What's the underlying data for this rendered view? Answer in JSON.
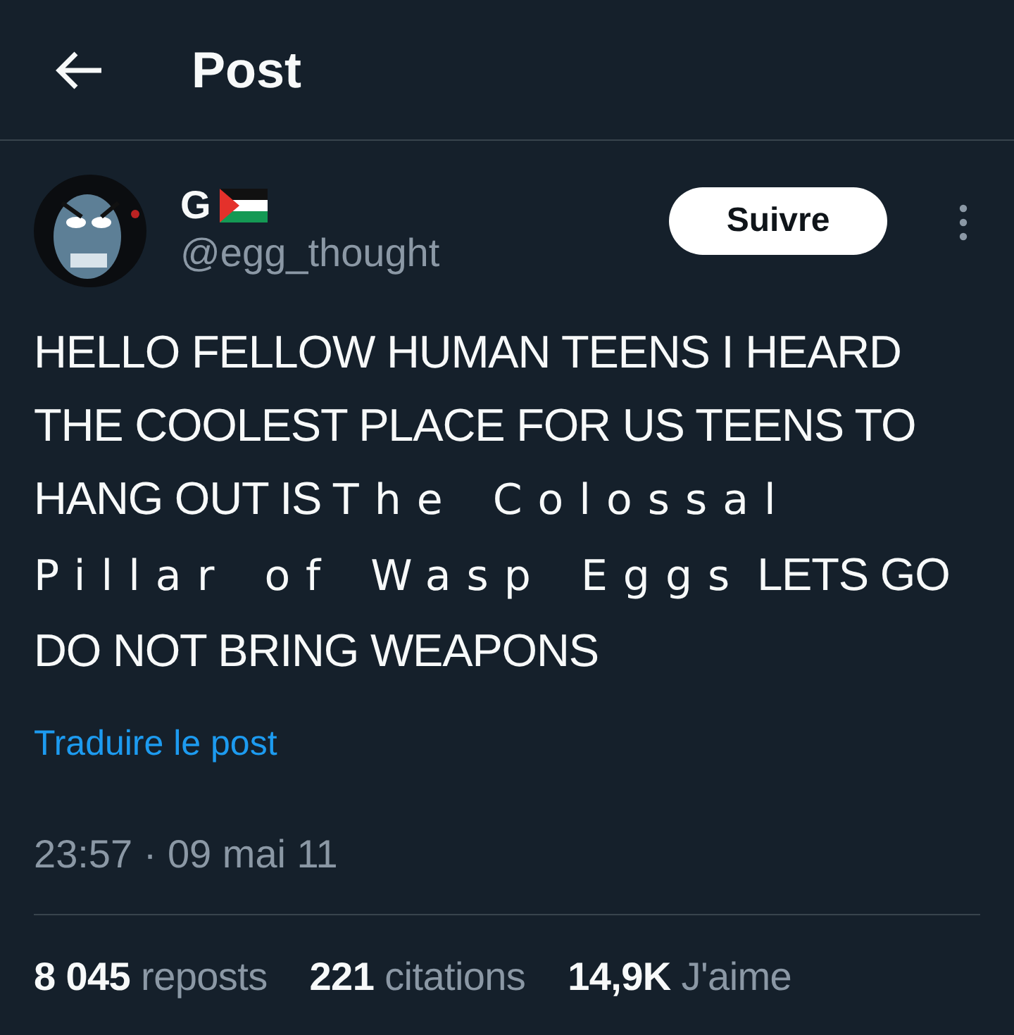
{
  "header": {
    "title": "Post"
  },
  "author": {
    "name": "G",
    "handle": "@egg_thought"
  },
  "follow_button": "Suivre",
  "post": {
    "segments": [
      {
        "kind": "plain",
        "text": "HELLO FELLOW HUMAN TEENS I HEARD THE COOLEST PLACE FOR US TEENS TO HANG OUT IS "
      },
      {
        "kind": "spaced",
        "text": "The Colossal Pillar of Wasp Eggs"
      },
      {
        "kind": "plain",
        "text": " LETS GO DO NOT BRING WEAPONS"
      }
    ]
  },
  "translate_link": "Traduire le post",
  "timestamp": "23:57 · 09 mai 11",
  "stats": [
    "**8 045** reposts",
    "**221** citations",
    "**14,9K** J'aime"
  ]
}
